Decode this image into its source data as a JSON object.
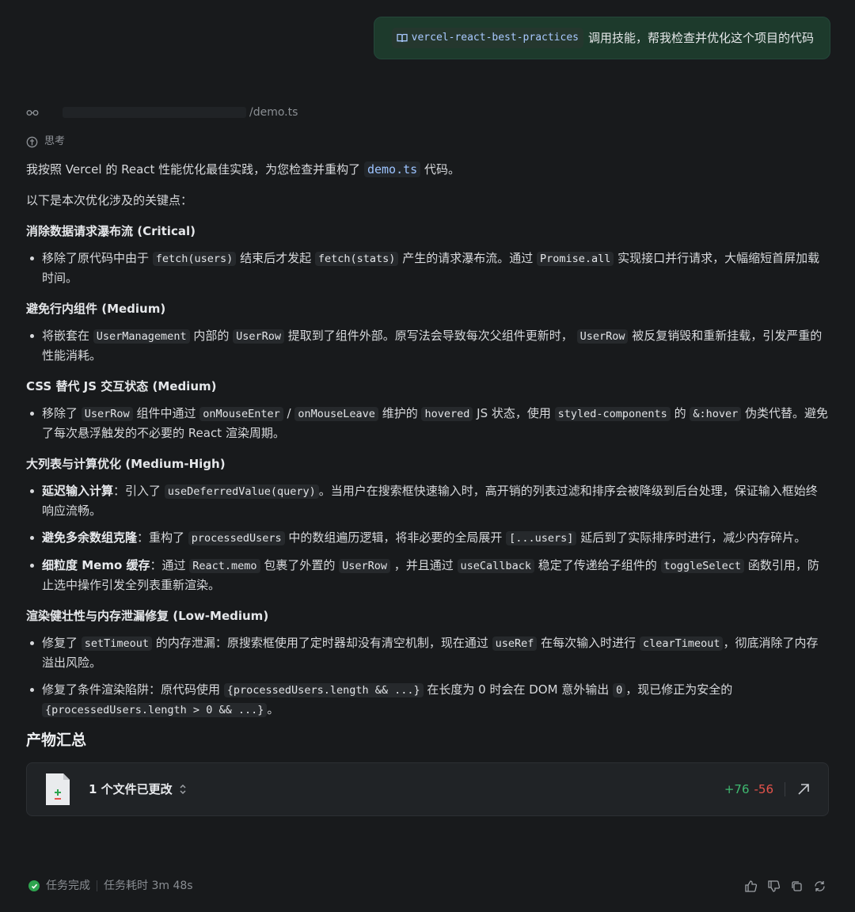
{
  "user_message": {
    "skill": "vercel-react-best-practices",
    "text": "调用技能，帮我检查并优化这个项目的代码"
  },
  "file_ref": {
    "path": "/demo.ts"
  },
  "thinking_label": "思考",
  "intro": {
    "before": "我按照 Vercel 的 React 性能优化最佳实践，为您检查并重构了 ",
    "code": "demo.ts",
    "after": " 代码。"
  },
  "lead": "以下是本次优化涉及的关键点：",
  "s1": {
    "title": "消除数据请求瀑布流 (Critical)",
    "i1": {
      "t1": "移除了原代码中由于 ",
      "c1": "fetch(users)",
      "t2": " 结束后才发起 ",
      "c2": "fetch(stats)",
      "t3": " 产生的请求瀑布流。通过 ",
      "c3": "Promise.all",
      "t4": " 实现接口并行请求，大幅缩短首屏加载时间。"
    }
  },
  "s2": {
    "title": "避免行内组件 (Medium)",
    "i1": {
      "t1": "将嵌套在 ",
      "c1": "UserManagement",
      "t2": " 内部的 ",
      "c2": "UserRow",
      "t3": " 提取到了组件外部。原写法会导致每次父组件更新时， ",
      "c3": "UserRow",
      "t4": " 被反复销毁和重新挂载，引发严重的性能消耗。"
    }
  },
  "s3": {
    "title": "CSS 替代 JS 交互状态 (Medium)",
    "i1": {
      "t1": "移除了 ",
      "c1": "UserRow",
      "t2": " 组件中通过 ",
      "c2": "onMouseEnter",
      "t3": " / ",
      "c3": "onMouseLeave",
      "t4": " 维护的 ",
      "c4": "hovered",
      "t5": " JS 状态，使用 ",
      "c5": "styled-components",
      "t6": " 的 ",
      "c6": "&:hover",
      "t7": " 伪类代替。避免了每次悬浮触发的不必要的 React 渲染周期。"
    }
  },
  "s4": {
    "title": "大列表与计算优化 (Medium-High)",
    "i1": {
      "b": "延迟输入计算",
      "t1": "：引入了 ",
      "c1": "useDeferredValue(query)",
      "t2": "。当用户在搜索框快速输入时，高开销的列表过滤和排序会被降级到后台处理，保证输入框始终响应流畅。"
    },
    "i2": {
      "b": "避免多余数组克隆",
      "t1": "：重构了 ",
      "c1": "processedUsers",
      "t2": " 中的数组遍历逻辑，将非必要的全局展开 ",
      "c2": "[...users]",
      "t3": " 延后到了实际排序时进行，减少内存碎片。"
    },
    "i3": {
      "b": "细粒度 Memo 缓存",
      "t1": "：通过 ",
      "c1": "React.memo",
      "t2": " 包裹了外置的 ",
      "c2": "UserRow",
      "t3": " ，并且通过 ",
      "c3": "useCallback",
      "t4": " 稳定了传递给子组件的 ",
      "c4": "toggleSelect",
      "t5": " 函数引用，防止选中操作引发全列表重新渲染。"
    }
  },
  "s5": {
    "title": "渲染健壮性与内存泄漏修复 (Low-Medium)",
    "i1": {
      "t1": "修复了 ",
      "c1": "setTimeout",
      "t2": " 的内存泄漏：原搜索框使用了定时器却没有清空机制，现在通过 ",
      "c2": "useRef",
      "t3": " 在每次输入时进行 ",
      "c3": "clearTimeout",
      "t4": "，彻底消除了内存溢出风险。"
    },
    "i2": {
      "t1": "修复了条件渲染陷阱：原代码使用 ",
      "c1": "{processedUsers.length && ...}",
      "t2": " 在长度为 0 时会在 DOM 意外输出 ",
      "c2": "0",
      "t3": "，现已修正为安全的 ",
      "c3": "{processedUsers.length > 0 && ...}",
      "t4": "。"
    }
  },
  "summary": {
    "title": "产物汇总",
    "files_changed": "1 个文件已更改",
    "additions": "+76",
    "deletions": "-56"
  },
  "footer": {
    "status": "任务完成",
    "duration": "任务耗时 3m 48s"
  },
  "colors": {
    "bg": "#181a1c",
    "accent_green": "#3fb970",
    "accent_red": "#e5534b",
    "link_blue": "#a9c9ff"
  },
  "icons": [
    "book-icon",
    "glasses-icon",
    "thinking-icon",
    "file-diff-icon",
    "chevron-updown-icon",
    "external-link-icon",
    "check-circle-icon",
    "thumbs-up-icon",
    "thumbs-down-icon",
    "copy-icon",
    "refresh-icon"
  ]
}
